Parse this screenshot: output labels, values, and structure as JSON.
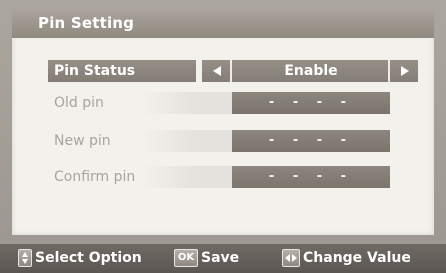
{
  "dialog": {
    "title": "Pin Setting"
  },
  "rows": {
    "pin_status": {
      "label": "Pin Status",
      "value": "Enable"
    },
    "old_pin": {
      "label": "Old pin",
      "value": "- - - -"
    },
    "new_pin": {
      "label": "New pin",
      "value": "- - - -"
    },
    "confirm_pin": {
      "label": "Confirm pin",
      "value": "- - - -"
    }
  },
  "footer": {
    "select_option": {
      "icon": "up-down-key-icon",
      "label": "Select Option"
    },
    "save": {
      "icon": "ok-key-icon",
      "key_text": "OK",
      "label": "Save"
    },
    "change_value": {
      "icon": "left-right-key-icon",
      "label": "Change Value"
    }
  },
  "colors": {
    "panel": "#f3f1ec",
    "highlight": "#8c867f",
    "footer": "#6f6a64"
  }
}
